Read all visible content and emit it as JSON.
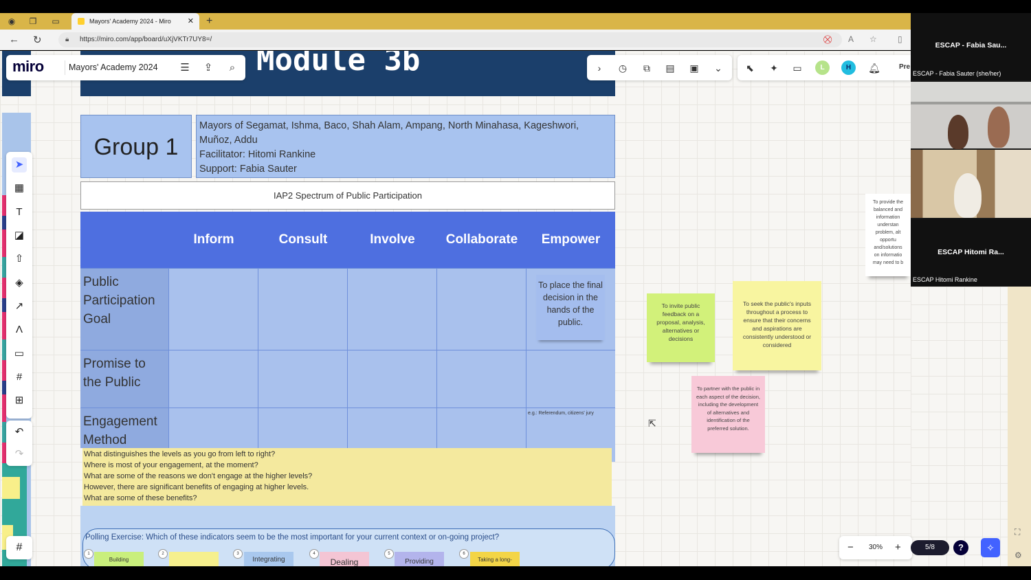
{
  "browser": {
    "tab_title": "Mayors' Academy 2024 - Miro",
    "tab_close": "✕",
    "new_tab": "+",
    "url": "https://miro.com/app/board/uXjVKTr7UY8=/"
  },
  "miro": {
    "logo": "miro",
    "board_name": "Mayors' Academy 2024",
    "present_label": "Pre",
    "avatars": [
      "L",
      "H"
    ],
    "zoom": "30%",
    "pages": "5/8",
    "help": "?"
  },
  "board": {
    "title": "Module 3b",
    "group": "Group 1",
    "mayors_lines": [
      "Mayors of Segamat, Ishma, Baco, Shah Alam, Ampang, North Minahasa, Kageshwori,",
      "Muñoz, Addu",
      "Facilitator: Hitomi Rankine",
      "Support: Fabia Sauter"
    ],
    "spectrum_title": "IAP2 Spectrum of Public Participation",
    "columns": [
      "Inform",
      "Consult",
      "Involve",
      "Collaborate",
      "Empower"
    ],
    "rows": [
      "Public Participation Goal",
      "Promise to the Public",
      "Engagement Method"
    ],
    "empower_goal": "To place the final decision in the hands of the public.",
    "example_note": "e.g.: Referendum, citizens' jury",
    "questions": [
      "What distinguishes the levels as you go from left to right?",
      "Where is most of your engagement, at the moment?",
      "What are some of the reasons we don't engage at the higher levels?",
      "However, there are significant benefits of engaging at higher levels.",
      "What are some of these benefits?"
    ],
    "poll_title": "Polling Exercise: Which of these indicators seem to be the most important for your current context or on-going project?",
    "poll_items": [
      {
        "num": "1",
        "label": "Building"
      },
      {
        "num": "2",
        "label": ""
      },
      {
        "num": "3",
        "label": "Integrating"
      },
      {
        "num": "4",
        "label": "Dealing"
      },
      {
        "num": "5",
        "label": "Providing"
      },
      {
        "num": "6",
        "label": "Taking a long-"
      }
    ]
  },
  "stickies": {
    "green": "To invite public feedback on a proposal, analysis, alternatives or decisions",
    "yellow": "To seek the public's inputs throughout a process to ensure that their concerns and aspirations are consistently understood or considered",
    "pink": "To partner with the public in each aspect of the decision, including the development of alternatives and identification of the preferred solution.",
    "white_lines": [
      "To provide the",
      "balanced and",
      "information",
      "understan",
      "problem, alt",
      "opportu",
      "and/solutions",
      "on informatio",
      "may need to b"
    ]
  },
  "video": {
    "tile1_name": "ESCAP - Fabia Sau...",
    "tile1_sub": "ESCAP - Fabia Sauter (she/her)",
    "tile4_name": "ESCAP Hitomi Ra...",
    "tile4_sub": "ESCAP Hitomi Rankine"
  },
  "colors": {
    "title_bar": "#1b3f6b",
    "table_header": "#4e6fe0",
    "table_cell": "#a9c1ed",
    "tab_bar": "#d9b548",
    "miro_blue": "#4262ff"
  }
}
